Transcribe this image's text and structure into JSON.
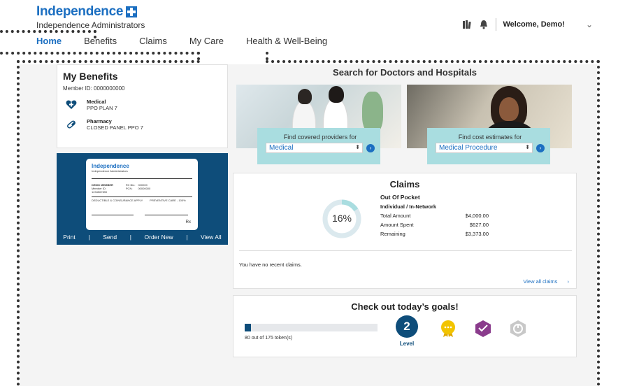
{
  "brand": {
    "name": "Independence",
    "subtitle": "Independence Administrators"
  },
  "header": {
    "welcome": "Welcome, Demo!",
    "icons": [
      "library-icon",
      "bell-icon",
      "chevron-down-icon"
    ]
  },
  "nav": [
    {
      "label": "Home",
      "active": true
    },
    {
      "label": "Benefits"
    },
    {
      "label": "Claims"
    },
    {
      "label": "My Care"
    },
    {
      "label": "Health & Well-Being"
    }
  ],
  "benefits": {
    "title": "My Benefits",
    "member_id": "Member ID: 0000000000",
    "items": [
      {
        "title": "Medical",
        "subtitle": "PPO PLAN 7",
        "icon": "heart-cross-icon"
      },
      {
        "title": "Pharmacy",
        "subtitle": "CLOSED PANEL PPO 7",
        "icon": "pill-icon"
      }
    ]
  },
  "id_card": {
    "brand": "Independence",
    "subtitle": "Independence Administrators",
    "member_label": "DEMO\nMEMBER",
    "member_id_label": "Member ID:",
    "member_id": "1234567890",
    "rx_bin_label": "RX Bin:",
    "rx_bin": "000000",
    "pcn_label": "PCN:",
    "pcn": "00000000",
    "deductible": "DEDUCTIBLE & COINSURANCE APPLY",
    "preventive": "PREVENTIVE CARE - 100%",
    "rx_mark": "Rx",
    "actions": [
      "Print",
      "Send",
      "Order New",
      "View All"
    ]
  },
  "search": {
    "title": "Search for Doctors and Hospitals",
    "providers": {
      "label": "Find covered providers for",
      "value": "Medical"
    },
    "costs": {
      "label": "Find cost estimates for",
      "value": "Medical Procedure"
    }
  },
  "claims": {
    "title": "Claims",
    "percent_label": "16%",
    "percent": 16,
    "heading": "Out Of Pocket",
    "subheading": "Individual / In-Network",
    "rows": [
      {
        "label": "Total Amount",
        "value": "$4,000.00"
      },
      {
        "label": "Amount Spent",
        "value": "$627.00"
      },
      {
        "label": "Remaining",
        "value": "$3,373.00"
      }
    ],
    "no_claims": "You have no recent claims.",
    "view_all": "View all claims"
  },
  "goals": {
    "title": "Check out today’s goals!",
    "progress_text": "80 out of 175 token(s)",
    "progress_fraction": 0.046,
    "level": "2",
    "level_label": "Level",
    "colors": {
      "accent": "#1c6fc1",
      "navy": "#0e4d7a",
      "teal": "#a9dde0",
      "gold": "#f2c400",
      "purple": "#8a3b8c"
    }
  }
}
